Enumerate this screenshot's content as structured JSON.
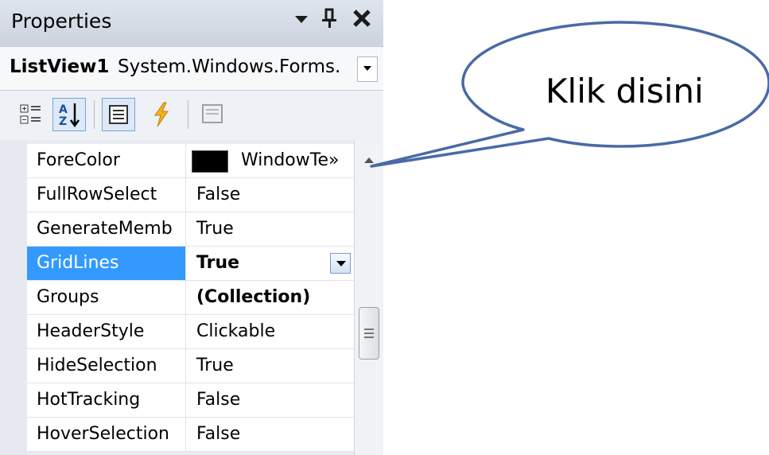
{
  "window": {
    "title": "Properties",
    "pin_glyph": "↑",
    "close_glyph": "✕"
  },
  "object_selector": {
    "name": "ListView1",
    "type": "System.Windows.Forms."
  },
  "toolbar": {
    "buttons": [
      {
        "icon": "categorized-icon",
        "checked": false
      },
      {
        "icon": "alphabetical-icon",
        "checked": true
      },
      {
        "icon": "properties-icon",
        "checked": true
      },
      {
        "icon": "events-icon",
        "checked": false
      },
      {
        "icon": "property-pages-icon",
        "checked": false
      }
    ]
  },
  "properties": [
    {
      "name": "ForeColor",
      "value": "WindowTe»",
      "swatch": "#000000"
    },
    {
      "name": "FullRowSelect",
      "value": "False"
    },
    {
      "name": "GenerateMemb",
      "value": "True"
    },
    {
      "name": "GridLines",
      "value": "True",
      "bold": true,
      "selected": true
    },
    {
      "name": "Groups",
      "value": "(Collection)",
      "bold": true
    },
    {
      "name": "HeaderStyle",
      "value": "Clickable"
    },
    {
      "name": "HideSelection",
      "value": "True"
    },
    {
      "name": "HotTracking",
      "value": "False"
    },
    {
      "name": "HoverSelection",
      "value": "False"
    }
  ],
  "callout": {
    "text": "Klik disini"
  },
  "colors": {
    "selection": "#3399ff",
    "accent_border": "#7da2ce"
  }
}
